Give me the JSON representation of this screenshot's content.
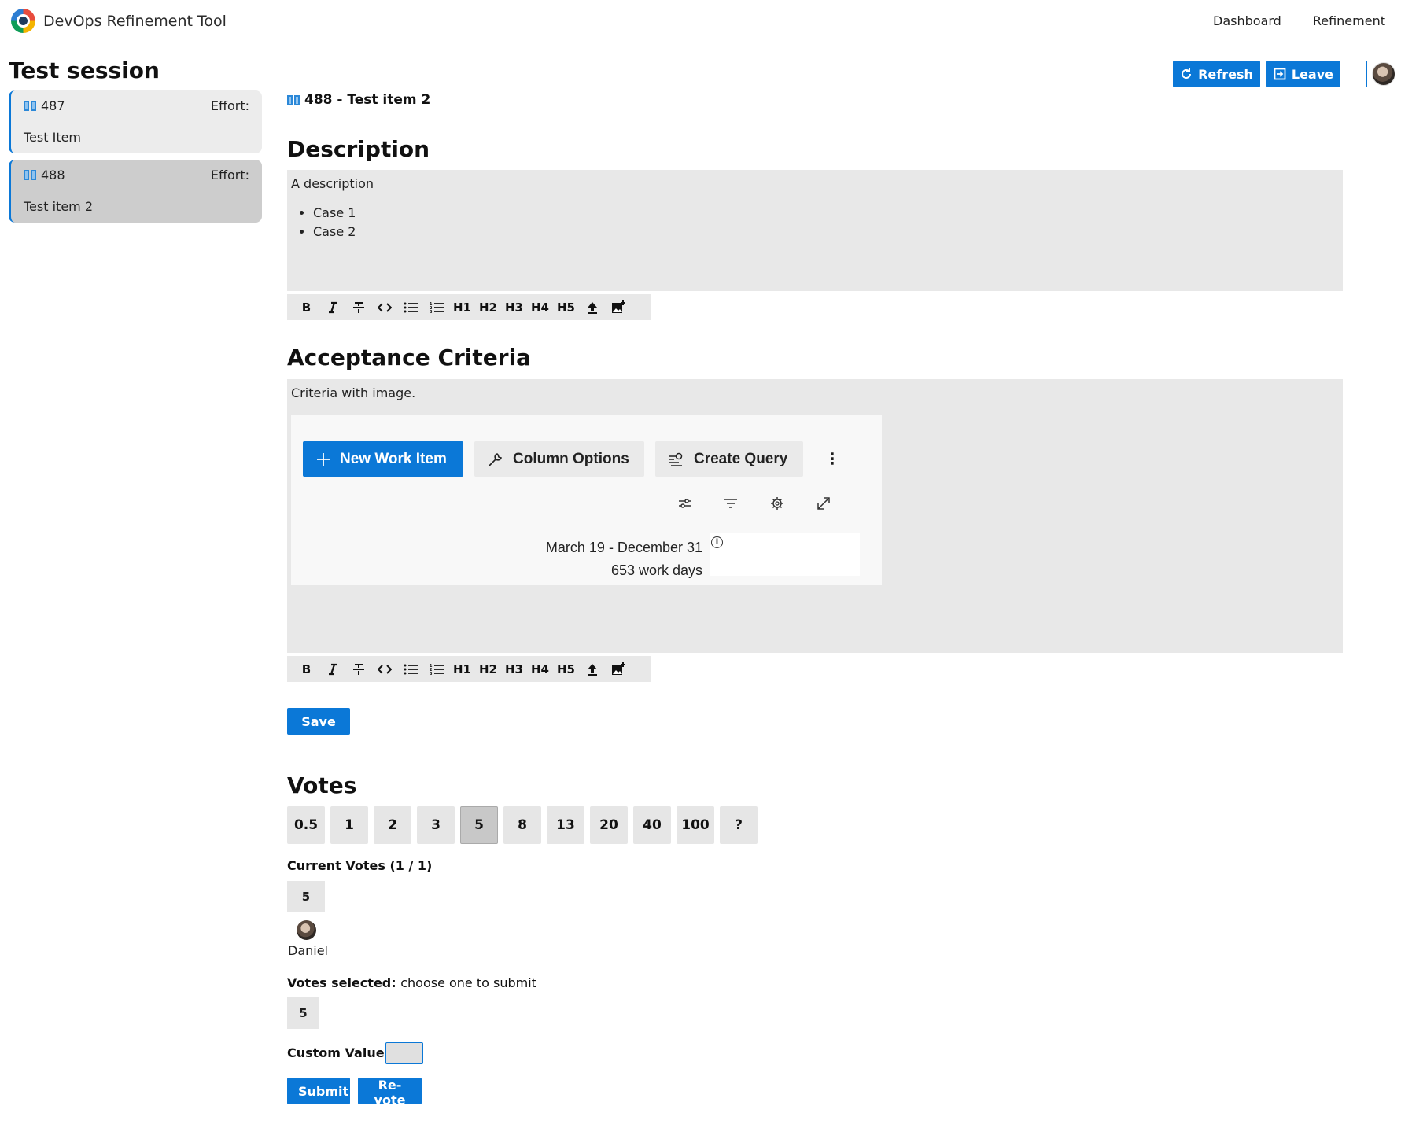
{
  "app": {
    "title": "DevOps Refinement Tool"
  },
  "nav": {
    "links": [
      "Dashboard",
      "Refinement"
    ]
  },
  "session": {
    "title": "Test session",
    "refresh_label": "Refresh",
    "leave_label": "Leave"
  },
  "items": [
    {
      "id": "487",
      "effort_label": "Effort:",
      "title": "Test Item"
    },
    {
      "id": "488",
      "effort_label": "Effort:",
      "title": "Test item 2"
    }
  ],
  "current_item": {
    "link": "488 - Test item 2",
    "description_heading": "Description",
    "description_text": "A description",
    "description_list": [
      "Case 1",
      "Case 2"
    ],
    "criteria_heading": "Acceptance Criteria",
    "criteria_text": "Criteria with image.",
    "save_label": "Save"
  },
  "toolbar": {
    "buttons": [
      "B",
      "I",
      "strikethrough",
      "code",
      "bulleted-list",
      "numbered-list",
      "H1",
      "H2",
      "H3",
      "H4",
      "H5",
      "upload",
      "image"
    ]
  },
  "embedded_image": {
    "new_work_item": "New Work Item",
    "column_options": "Column Options",
    "create_query": "Create Query",
    "date_range": "March 19 - December 31",
    "work_days": "653 work days"
  },
  "votes": {
    "heading": "Votes",
    "options": [
      "0.5",
      "1",
      "2",
      "3",
      "5",
      "8",
      "13",
      "20",
      "40",
      "100",
      "?"
    ],
    "selected": "5",
    "current_label": "Current Votes (1 / 1)",
    "current_vote": "5",
    "voter": "Daniel",
    "selected_label": "Votes selected:",
    "selected_hint": "choose one to submit",
    "selected_value": "5",
    "custom_label": "Custom Value:",
    "submit_label": "Submit",
    "revote_label": "Re-vote"
  },
  "colors": {
    "accent": "#0b78d7",
    "panel": "#e8e8e8"
  }
}
